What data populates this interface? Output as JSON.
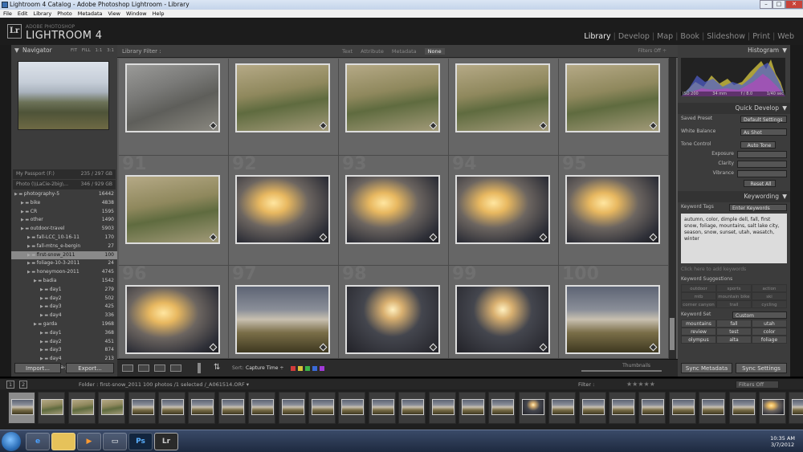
{
  "window": {
    "title": "Lightroom 4 Catalog - Adobe Photoshop Lightroom - Library",
    "buttons": [
      "–",
      "□",
      "✕"
    ]
  },
  "menu": [
    "File",
    "Edit",
    "Library",
    "Photo",
    "Metadata",
    "View",
    "Window",
    "Help"
  ],
  "brand": {
    "logo": "Lr",
    "sub": "ADOBE PHOTOSHOP",
    "name": "LIGHTROOM 4"
  },
  "modules": [
    {
      "label": "Library",
      "active": true
    },
    {
      "label": "Develop"
    },
    {
      "label": "Map"
    },
    {
      "label": "Book"
    },
    {
      "label": "Slideshow"
    },
    {
      "label": "Print"
    },
    {
      "label": "Web"
    }
  ],
  "navigator": {
    "title": "Navigator",
    "zoom": [
      "FIT",
      "FILL",
      "1:1",
      "3:1"
    ]
  },
  "sources": [
    {
      "label": "My Passport (F:)",
      "size": "235 / 297 GB"
    },
    {
      "label": "Photo (\\\\LaCie-2big\\...",
      "size": "346 / 929 GB"
    }
  ],
  "folders": [
    {
      "name": "photography-5",
      "count": "16442",
      "indent": 0
    },
    {
      "name": "bike",
      "count": "4838",
      "indent": 1
    },
    {
      "name": "CR",
      "count": "1595",
      "indent": 1
    },
    {
      "name": "other",
      "count": "1490",
      "indent": 1
    },
    {
      "name": "outdoor-travel",
      "count": "5903",
      "indent": 1
    },
    {
      "name": "fall-LCC_10-16-11",
      "count": "170",
      "indent": 2
    },
    {
      "name": "fall-mtns_e-bergin",
      "count": "27",
      "indent": 2
    },
    {
      "name": "first-snow_2011",
      "count": "100",
      "indent": 2,
      "selected": true
    },
    {
      "name": "foliage-10-3-2011",
      "count": "24",
      "indent": 2
    },
    {
      "name": "honeymoon-2011",
      "count": "4745",
      "indent": 2
    },
    {
      "name": "badia",
      "count": "1542",
      "indent": 3
    },
    {
      "name": "day1",
      "count": "279",
      "indent": 4
    },
    {
      "name": "day2",
      "count": "502",
      "indent": 4
    },
    {
      "name": "day3",
      "count": "425",
      "indent": 4
    },
    {
      "name": "day4",
      "count": "336",
      "indent": 4
    },
    {
      "name": "garda",
      "count": "1968",
      "indent": 3
    },
    {
      "name": "day1",
      "count": "368",
      "indent": 4
    },
    {
      "name": "day2",
      "count": "451",
      "indent": 4
    },
    {
      "name": "day3",
      "count": "874",
      "indent": 4
    },
    {
      "name": "day4",
      "count": "213",
      "indent": 4
    },
    {
      "name": "garda-pano",
      "count": "62",
      "indent": 4
    }
  ],
  "left_buttons": {
    "import": "Import...",
    "export": "Export..."
  },
  "library_filter": {
    "label": "Library Filter :",
    "options": [
      "Text",
      "Attribute",
      "Metadata",
      "None"
    ],
    "active": "None",
    "filters_off": "Filters Off ÷"
  },
  "grid": {
    "numbers": [
      "",
      "",
      "",
      "",
      "",
      "91",
      "92",
      "93",
      "94",
      "95",
      "96",
      "97",
      "98",
      "99",
      "100"
    ],
    "types": [
      "rock",
      "hill",
      "hill",
      "hill",
      "hill",
      "hill",
      "cloud",
      "cloud",
      "cloud",
      "cloud",
      "cloud",
      "mtn",
      "sunset",
      "sunset",
      "mtn"
    ]
  },
  "toolbar": {
    "sort_label": "Sort:",
    "sort_value": "Capture Time ÷",
    "thumbnails": "Thumbnails",
    "colors": [
      "#d23b3b",
      "#d8c23a",
      "#3bb34a",
      "#3a6ad8",
      "#a23ad8"
    ]
  },
  "histogram": {
    "title": "Histogram",
    "iso": "ISO 200",
    "focal": "34 mm",
    "aperture": "f / 8.0",
    "shutter": "1/40 sec"
  },
  "quick_develop": {
    "title": "Quick Develop",
    "saved_preset_label": "Saved Preset",
    "saved_preset": "Default Settings",
    "wb_label": "White Balance",
    "wb": "As Shot",
    "tone_label": "Tone Control",
    "auto_tone": "Auto Tone",
    "exposure": "Exposure",
    "clarity": "Clarity",
    "vibrance": "Vibrance",
    "reset": "Reset All"
  },
  "keywording": {
    "title": "Keywording",
    "tags_label": "Keyword Tags",
    "tags_mode": "Enter Keywords",
    "keywords": "autumn, color, dimple dell, fall, first snow, foliage, mountains, salt lake city, season, snow, sunset, utah, wasatch, winter",
    "add_hint": "Click here to add keywords",
    "sugg_title": "Keyword Suggestions",
    "suggestions": [
      "outdoor",
      "sports",
      "action",
      "mtb",
      "mountain bike",
      "ski",
      "corner canyon",
      "trail",
      "cycling"
    ],
    "set_label": "Keyword Set",
    "set_value": "Custom",
    "set": [
      "mountains",
      "fall",
      "utah",
      "review",
      "test",
      "color",
      "olympus",
      "alta",
      "foliage"
    ]
  },
  "right_buttons": {
    "sync_meta": "Sync Metadata",
    "sync": "Sync Settings"
  },
  "filmstrip_header": {
    "page1": "1",
    "page2": "2",
    "folder": "Folder : first-snow_2011",
    "count": "100 photos /1 selected /_A061514.ORF ▾",
    "filter": "Filter :",
    "filters_off": "Filters Off"
  },
  "film_types": [
    "mtn",
    "hill",
    "hill",
    "hill",
    "mtn",
    "mtn",
    "mtn",
    "mtn",
    "mtn",
    "mtn",
    "mtn",
    "mtn",
    "mtn",
    "mtn",
    "mtn",
    "mtn",
    "mtn",
    "sunset",
    "mtn",
    "mtn",
    "mtn",
    "mtn",
    "mtn",
    "mtn",
    "mtn",
    "cloud",
    "mtn"
  ],
  "taskbar": {
    "apps": [
      "e",
      "📁",
      "▶",
      "▭",
      "Ps",
      "Lr"
    ],
    "time": "10:35 AM",
    "date": "3/7/2012"
  }
}
